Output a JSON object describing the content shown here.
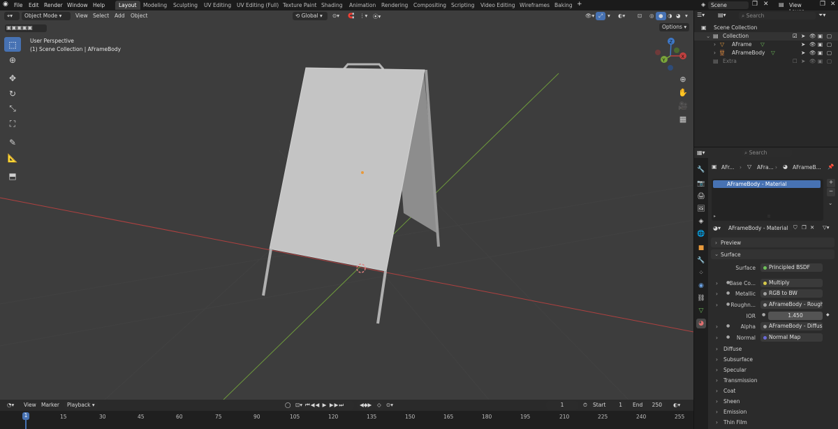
{
  "menu": [
    "File",
    "Edit",
    "Render",
    "Window",
    "Help"
  ],
  "workspaces": [
    {
      "label": "Layout",
      "active": true
    },
    {
      "label": "Modeling"
    },
    {
      "label": "Sculpting"
    },
    {
      "label": "UV Editing"
    },
    {
      "label": "UV Editing (Full)"
    },
    {
      "label": "Texture Paint"
    },
    {
      "label": "Shading"
    },
    {
      "label": "Animation"
    },
    {
      "label": "Rendering"
    },
    {
      "label": "Compositing"
    },
    {
      "label": "Scripting"
    },
    {
      "label": "Video Editing"
    },
    {
      "label": "Wireframes"
    },
    {
      "label": "Baking"
    }
  ],
  "scene": {
    "name": "Scene",
    "view_layer": "View Layer",
    "search_placeholder": "Search"
  },
  "viewport": {
    "mode": "Object Mode",
    "menus": [
      "View",
      "Select",
      "Add",
      "Object"
    ],
    "transform_orientation": "Global",
    "options_label": "Options",
    "info_line1": "User Perspective",
    "info_line2": "(1) Scene Collection | AFrameBody",
    "gizmo_axes": [
      "X",
      "Y",
      "Z"
    ]
  },
  "outliner": {
    "root": "Scene Collection",
    "collection": "Collection",
    "items": [
      "AFrame",
      "AFrameBody"
    ],
    "extra": "Extra"
  },
  "properties": {
    "search_placeholder": "Search",
    "breadcrumb": [
      "AFr...",
      "AFra...",
      "AFrameB..."
    ],
    "material_slot": "AFrameBody - Material",
    "material_name": "AFrameBody - Material",
    "preview_label": "Preview",
    "surface_label": "Surface",
    "rows": [
      {
        "label": "Surface",
        "value": "Principled BSDF",
        "dot": "#6ebf5a"
      },
      {
        "label": "Base Co...",
        "value": "Multiply",
        "dot": "#d6c94a",
        "expand": true
      },
      {
        "label": "Metallic",
        "value": "RGB to BW",
        "dot": "#a1a1a1",
        "expand": true
      },
      {
        "label": "Roughn...",
        "value": "AFrameBody - Rough...",
        "dot": "#a1a1a1",
        "expand": true
      },
      {
        "label": "IOR",
        "value": "1.450",
        "dot": "#a1a1a1"
      },
      {
        "label": "Alpha",
        "value": "AFrameBody - Diffuse...",
        "dot": "#a1a1a1",
        "expand": true
      },
      {
        "label": "Normal",
        "value": "Normal Map",
        "dot": "#6a6ad6",
        "expand": true
      }
    ],
    "subpanels": [
      "Diffuse",
      "Subsurface",
      "Specular",
      "Transmission",
      "Coat",
      "Sheen",
      "Emission",
      "Thin Film"
    ]
  },
  "timeline": {
    "menus": [
      "View",
      "Marker",
      "Playback"
    ],
    "current_frame": "1",
    "start_label": "Start",
    "start": "1",
    "end_label": "End",
    "end": "250",
    "ticks": [
      "1",
      "15",
      "30",
      "45",
      "60",
      "75",
      "90",
      "105",
      "120",
      "135",
      "150",
      "165",
      "180",
      "195",
      "210",
      "225",
      "240",
      "255"
    ]
  },
  "colors": {
    "accent": "#4772b3",
    "x_axis": "#c0403f",
    "y_axis": "#7aa53a",
    "z_axis": "#3e78c8"
  }
}
